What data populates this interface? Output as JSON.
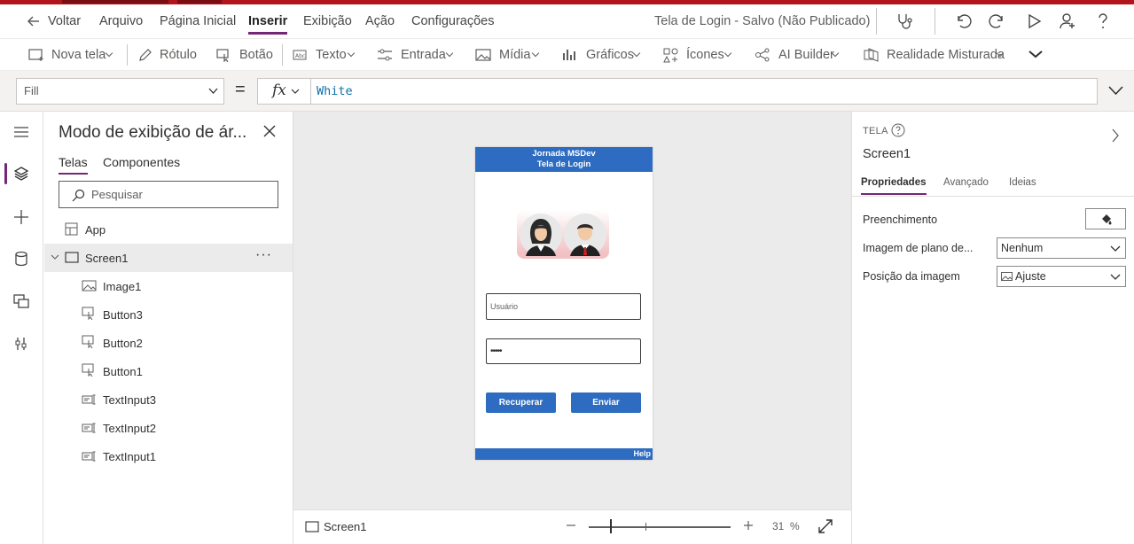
{
  "menu": {
    "back": "Voltar",
    "items": [
      "Arquivo",
      "Página Inicial",
      "Inserir",
      "Exibição",
      "Ação",
      "Configurações"
    ],
    "active": "Inserir",
    "doc_title": "Tela de Login - Salvo (Não Publicado)",
    "actions": [
      "stethoscope-icon",
      "undo-icon",
      "redo-icon",
      "play-icon",
      "share-user-icon",
      "help-icon"
    ]
  },
  "ribbon": {
    "new_screen": "Nova tela",
    "label": "Rótulo",
    "button": "Botão",
    "text": "Texto",
    "input": "Entrada",
    "media": "Mídia",
    "charts": "Gráficos",
    "icons": "Ícones",
    "ai_builder": "AI Builder",
    "mixed_reality": "Realidade Misturada"
  },
  "formula": {
    "property": "Fill",
    "equals": "=",
    "fx": "fx",
    "value": "White"
  },
  "tree": {
    "title": "Modo de exibição de ár...",
    "tabs": [
      "Telas",
      "Componentes"
    ],
    "search_placeholder": "Pesquisar",
    "app": "App",
    "screen": "Screen1",
    "more": "···",
    "children": [
      "Image1",
      "Button3",
      "Button2",
      "Button1",
      "TextInput3",
      "TextInput2",
      "TextInput1"
    ]
  },
  "phone": {
    "header_line1": "Jornada MSDev",
    "header_line2": "Tela de Login",
    "user_placeholder": "Usuário",
    "password_value": "•••••",
    "btn_recover": "Recuperar",
    "btn_send": "Enviar",
    "footer": "Help"
  },
  "status": {
    "screen": "Screen1",
    "zoom": "31",
    "zoom_unit": "%"
  },
  "props": {
    "kind": "TELA",
    "name": "Screen1",
    "tabs": [
      "Propriedades",
      "Avançado",
      "Ideias"
    ],
    "fill_label": "Preenchimento",
    "bg_image_label": "Imagem de plano de...",
    "bg_image_value": "Nenhum",
    "image_position_label": "Posição da imagem",
    "image_position_value": "Ajuste"
  },
  "colors": {
    "accent": "#742774",
    "app_blue": "#2d6cc0",
    "top_strip": "#b3131b"
  }
}
